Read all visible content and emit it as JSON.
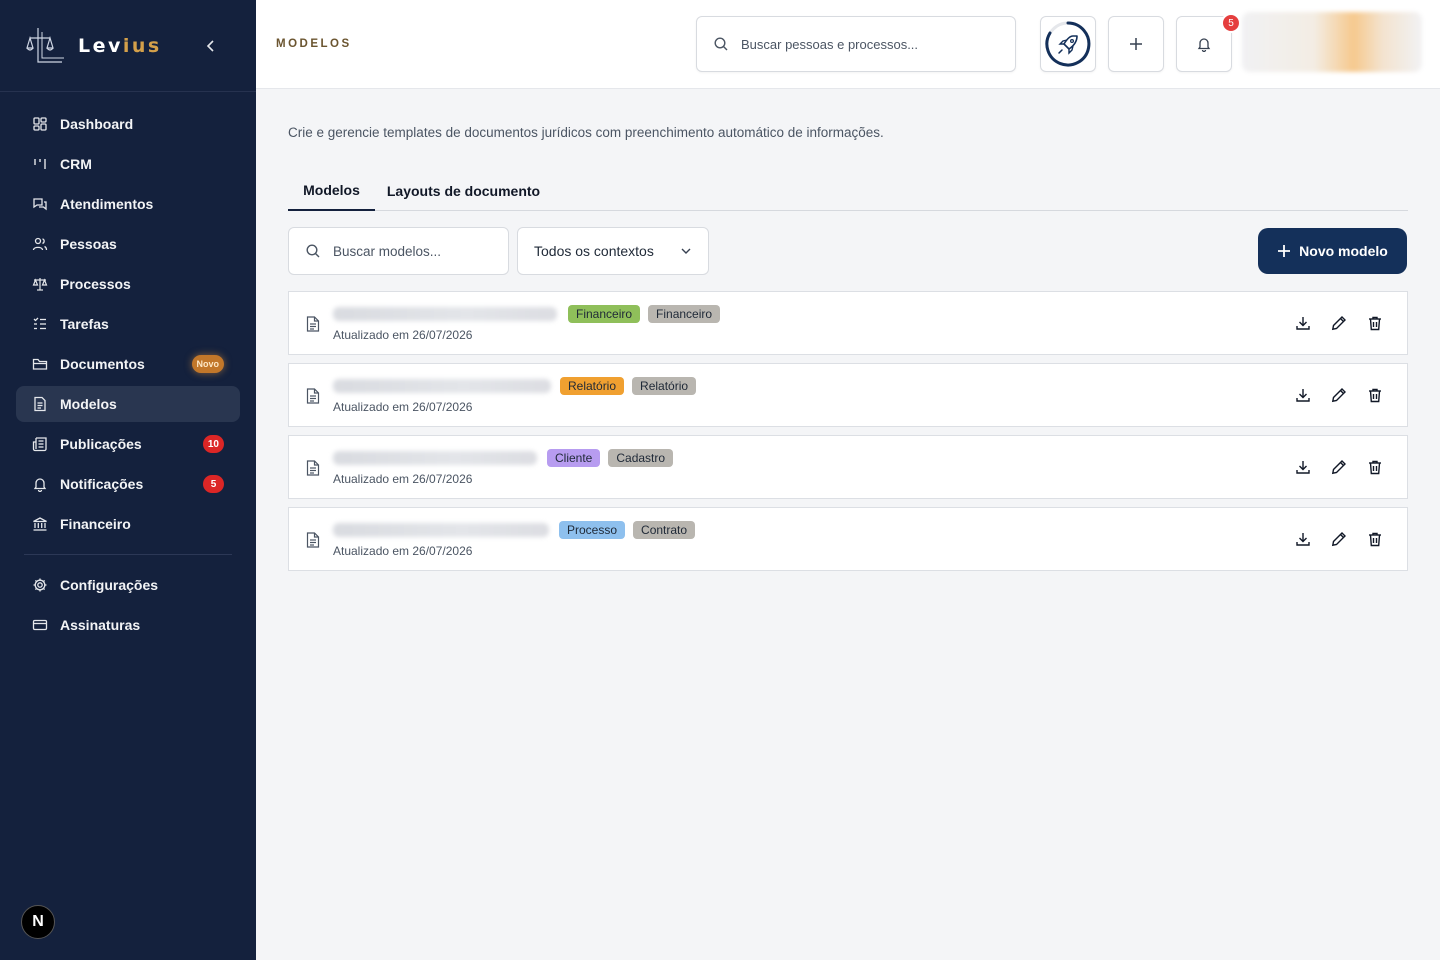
{
  "app": {
    "brand_part1": "Lev",
    "brand_part2": "ius"
  },
  "sidebar": {
    "items": [
      {
        "label": "Dashboard",
        "icon": "dashboard-icon"
      },
      {
        "label": "CRM",
        "icon": "kanban-icon"
      },
      {
        "label": "Atendimentos",
        "icon": "chat-icon"
      },
      {
        "label": "Pessoas",
        "icon": "users-icon"
      },
      {
        "label": "Processos",
        "icon": "scale-icon"
      },
      {
        "label": "Tarefas",
        "icon": "tasks-icon"
      },
      {
        "label": "Documentos",
        "icon": "folder-icon",
        "badge": "Novo"
      },
      {
        "label": "Modelos",
        "icon": "file-icon",
        "active": true
      },
      {
        "label": "Publicações",
        "icon": "newspaper-icon",
        "badge": "10"
      },
      {
        "label": "Notificações",
        "icon": "bell-icon",
        "badge": "5"
      },
      {
        "label": "Financeiro",
        "icon": "bank-icon"
      }
    ],
    "bottom_items": [
      {
        "label": "Configurações",
        "icon": "gear-icon"
      },
      {
        "label": "Assinaturas",
        "icon": "credit-card-icon"
      }
    ],
    "next_badge": "N"
  },
  "header": {
    "page_label": "MODELOS",
    "search_placeholder": "Buscar pessoas e processos...",
    "notification_count": "5"
  },
  "main": {
    "description": "Crie e gerencie templates de documentos jurídicos com preenchimento automático de informações.",
    "tabs": [
      {
        "label": "Modelos",
        "active": true
      },
      {
        "label": "Layouts de documento",
        "active": false
      }
    ],
    "search_placeholder": "Buscar modelos...",
    "context_select": "Todos os contextos",
    "new_button": "Novo modelo"
  },
  "models": [
    {
      "updated": "Atualizado em 26/07/2026",
      "tags": [
        {
          "label": "Financeiro",
          "color": "#8fbf5a"
        },
        {
          "label": "Financeiro",
          "color": "#b9b6b0"
        }
      ]
    },
    {
      "updated": "Atualizado em 26/07/2026",
      "tags": [
        {
          "label": "Relatório",
          "color": "#f0a030"
        },
        {
          "label": "Relatório",
          "color": "#b9b6b0"
        }
      ]
    },
    {
      "updated": "Atualizado em 26/07/2026",
      "tags": [
        {
          "label": "Cliente",
          "color": "#b79cf0"
        },
        {
          "label": "Cadastro",
          "color": "#b9b6b0"
        }
      ]
    },
    {
      "updated": "Atualizado em 26/07/2026",
      "tags": [
        {
          "label": "Processo",
          "color": "#8ec0ee"
        },
        {
          "label": "Contrato",
          "color": "#b9b6b0"
        }
      ]
    }
  ],
  "colors": {
    "sidebar_bg": "#14213d",
    "primary_button": "#14305a",
    "badge_red": "#dc2626",
    "badge_novo": "#c2772a"
  }
}
